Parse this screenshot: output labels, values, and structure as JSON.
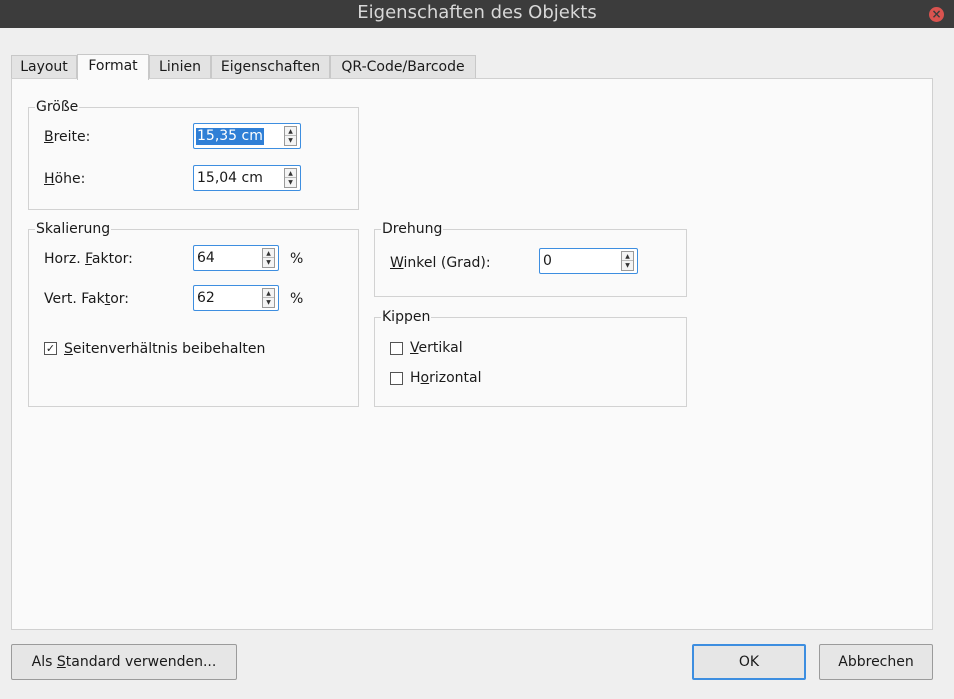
{
  "window": {
    "title": "Eigenschaften des Objekts"
  },
  "tabs": [
    {
      "label": "Layout"
    },
    {
      "label": "Format"
    },
    {
      "label": "Linien"
    },
    {
      "label": "Eigenschaften"
    },
    {
      "label": "QR-Code/Barcode"
    }
  ],
  "groesse": {
    "title": "Größe",
    "breite_label_u": "B",
    "breite_label_rest": "reite:",
    "breite_value": "15,35 cm",
    "hoehe_label_u": "H",
    "hoehe_label_rest": "öhe:",
    "hoehe_value": "15,04 cm"
  },
  "skalierung": {
    "title": "Skalierung",
    "horz_label_a": "Horz. ",
    "horz_label_u": "F",
    "horz_label_b": "aktor:",
    "horz_value": "64",
    "horz_unit": "%",
    "vert_label_a": "Vert. Fak",
    "vert_label_u": "t",
    "vert_label_b": "or:",
    "vert_value": "62",
    "vert_unit": "%",
    "keep_ratio_u": "S",
    "keep_ratio_rest": "eitenverhältnis beibehalten",
    "keep_ratio_checked": true
  },
  "drehung": {
    "title": "Drehung",
    "winkel_label_u": "W",
    "winkel_label_rest": "inkel (Grad):",
    "winkel_value": "0"
  },
  "kippen": {
    "title": "Kippen",
    "vertikal_u": "V",
    "vertikal_rest": "ertikal",
    "vertikal_checked": false,
    "horizontal_a": "H",
    "horizontal_u": "o",
    "horizontal_rest": "rizontal",
    "horizontal_checked": false
  },
  "buttons": {
    "standard_a": "Als ",
    "standard_u": "S",
    "standard_rest": "tandard verwenden...",
    "ok": "OK",
    "cancel": "Abbrechen"
  },
  "icons": {
    "close": "close-icon",
    "spin_up": "arrow-up-icon",
    "spin_down": "arrow-down-icon",
    "check": "checkmark-icon"
  },
  "colors": {
    "titlebar": "#3c3c3c",
    "accent": "#3d8ee0",
    "close": "#d9534f"
  }
}
